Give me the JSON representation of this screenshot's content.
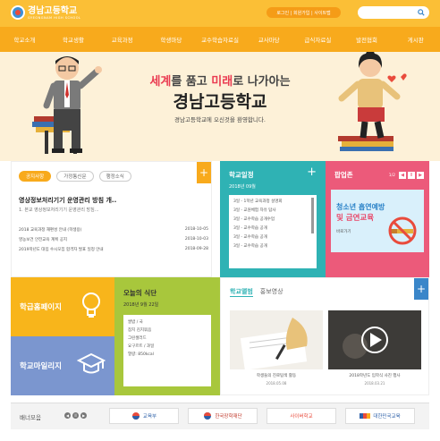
{
  "header": {
    "logo_name": "경남고등학교",
    "logo_en": "GYEONGNAM HIGH SCHOOL",
    "util_links": "로그인 | 회원가입 | 사이트맵",
    "search_placeholder": ""
  },
  "nav": [
    "학교소개",
    "학교생활",
    "교육과정",
    "학생마당",
    "교수학습자료실",
    "교사마당",
    "급식자료실",
    "발전협회",
    "게시판"
  ],
  "hero": {
    "line1_a": "세계",
    "line1_b": "를 품고 ",
    "line1_c": "미래",
    "line1_d": "로 나가아는",
    "title": "경남고등학교",
    "welcome": "경남고등학교에 오신것을 환영합니다."
  },
  "notice": {
    "tabs": [
      "공지사항",
      "가정통신문",
      "행정소식"
    ],
    "plus": "+",
    "featured_title": "영상정보처리기기 운영관리 방침 개..",
    "featured_sub": "1. 본교 영상정보처리기기 운영관리 방침...",
    "items": [
      {
        "title": "2018 교육과정 재편성 안내 (학생용)",
        "date": "2018-10-05"
      },
      {
        "title": "영농보건 안전교육 계획 공지",
        "date": "2018-10-03"
      },
      {
        "title": "2019학년도 대입 수시모집 합격자 발표 일정 안내",
        "date": "2018-09-28"
      }
    ]
  },
  "schedule": {
    "title": "학교일정",
    "plus": "+",
    "month": "2018년 09월",
    "items": [
      "3일 - 1학년 교육과정 설명회",
      "3일 - 교원체험 자유 답사",
      "3일 - 교수학습 공개수업",
      "3일 - 교수학습 공개",
      "3일 - 교수학습 공개",
      "3일 - 교수학습 공개"
    ]
  },
  "popup": {
    "title": "팝업존",
    "count": "1/2",
    "nav": [
      "◀",
      "II",
      "▶"
    ],
    "line1": "청소년 흡연예방",
    "line2": "및 금연교육",
    "btn": "바로가기"
  },
  "tiles": {
    "homepage": "학급홈페이지",
    "mileage": "학교마일리지"
  },
  "meal": {
    "title": "오늘의 식단",
    "date": "2018년 9월 22일",
    "menu": [
      "쌀밥 / 국",
      "참치 김치볶음",
      "그린샐러드",
      "요구르트 / 과일",
      "열량: 850kcal"
    ]
  },
  "album": {
    "tabs": [
      "학교앨범",
      "홍보영상"
    ],
    "plus": "+",
    "items": [
      {
        "caption": "학생들의 진로탐색 활동",
        "date": "2018.05.08"
      },
      {
        "caption": "2018학년도 입학식 사진 행사",
        "date": "2018.03.21"
      }
    ]
  },
  "banner": {
    "label": "배너모음",
    "nav": [
      "◀",
      "II",
      "▶"
    ],
    "links": [
      "교육부",
      "한국장학재단",
      "사이버학교",
      "대한민국교육"
    ]
  },
  "colors": {
    "accent": "#fbbf36",
    "nav": "#f8aa1c",
    "teal": "#2fb2b4",
    "pink": "#ec5a7a",
    "green": "#a8c73c",
    "blue": "#7b96cf"
  }
}
